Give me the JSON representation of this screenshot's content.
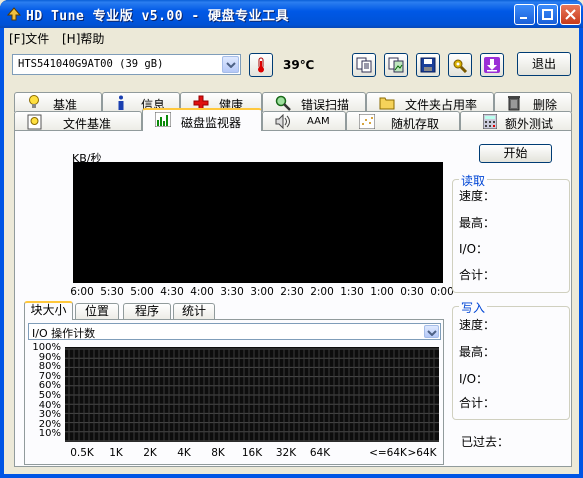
{
  "window": {
    "title": "HD Tune 专业版 v5.00 - 硬盘专业工具"
  },
  "menu": {
    "items": [
      {
        "label": "[F]文件"
      },
      {
        "label": "[H]帮助"
      }
    ]
  },
  "toolbar": {
    "drive": "HTS541040G9AT00 (39 gB)",
    "temperature": "39℃",
    "exit_label": "退出"
  },
  "tabs": {
    "row1": [
      {
        "label": "基准",
        "icon": "lightbulb-icon"
      },
      {
        "label": "信息",
        "icon": "info-icon"
      },
      {
        "label": "健康",
        "icon": "red-cross-icon"
      },
      {
        "label": "错误扫描",
        "icon": "magnifier-icon"
      },
      {
        "label": "文件夹占用率",
        "icon": "folder-icon"
      },
      {
        "label": "删除",
        "icon": "trash-icon"
      }
    ],
    "row2": [
      {
        "label": "文件基准",
        "icon": "file-bulb-icon"
      },
      {
        "label": "磁盘监视器",
        "icon": "bar-chart-icon"
      },
      {
        "label": "AAM",
        "icon": "speaker-icon"
      },
      {
        "label": "随机存取",
        "icon": "scatter-icon"
      },
      {
        "label": "额外测试",
        "icon": "calculator-icon"
      }
    ],
    "active": "磁盘监视器"
  },
  "monitor": {
    "y_unit": "KB/秒",
    "time_labels": [
      "6:00",
      "5:30",
      "5:00",
      "4:30",
      "4:00",
      "3:30",
      "3:00",
      "2:30",
      "2:00",
      "1:30",
      "1:00",
      "0:30",
      "0:00"
    ],
    "start_label": "开始",
    "read": {
      "title": "读取",
      "speed": "速度：",
      "max": "最高：",
      "io": "I/O：",
      "total": "合计："
    },
    "write": {
      "title": "写入",
      "speed": "速度：",
      "max": "最高：",
      "io": "I/O：",
      "total": "合计："
    },
    "elapsed": "已过去："
  },
  "subtabs": {
    "items": [
      "块大小",
      "位置",
      "程序",
      "统计"
    ],
    "active": "块大小"
  },
  "histogram": {
    "combo_value": "I/O 操作计数",
    "pct_labels": [
      "100%",
      "90%",
      "80%",
      "70%",
      "60%",
      "50%",
      "40%",
      "30%",
      "20%",
      "10%"
    ],
    "block_labels": [
      "0.5K",
      "1K",
      "2K",
      "4K",
      "8K",
      "16K",
      "32K",
      "64K",
      "<=64K",
      ">64K"
    ]
  },
  "colors": {
    "titlebar": "#0058e6",
    "group_title": "#0046d5",
    "active_tab_accent": "#ffc83c"
  }
}
